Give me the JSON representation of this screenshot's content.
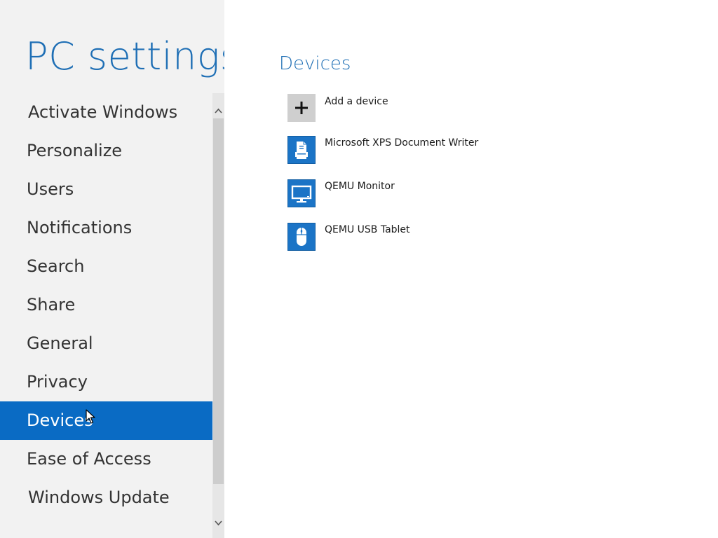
{
  "app": {
    "title": "PC settings"
  },
  "nav": {
    "items": [
      {
        "label": "Activate Windows"
      },
      {
        "label": "Personalize"
      },
      {
        "label": "Users"
      },
      {
        "label": "Notifications"
      },
      {
        "label": "Search"
      },
      {
        "label": "Share"
      },
      {
        "label": "General"
      },
      {
        "label": "Privacy"
      },
      {
        "label": "Devices",
        "selected": true
      },
      {
        "label": "Ease of Access"
      },
      {
        "label": "Windows Update"
      }
    ]
  },
  "content": {
    "section_title": "Devices",
    "devices": [
      {
        "label": "Add a device",
        "icon": "plus-icon"
      },
      {
        "label": "Microsoft XPS Document Writer",
        "icon": "printer-icon"
      },
      {
        "label": "QEMU Monitor",
        "icon": "monitor-icon"
      },
      {
        "label": "QEMU USB Tablet",
        "icon": "mouse-icon"
      }
    ]
  },
  "colors": {
    "accent": "#1f6fb5",
    "selected_bg": "#0a6bc4",
    "nav_bg": "#f2f2f2",
    "device_tile": "#1b74c6"
  }
}
